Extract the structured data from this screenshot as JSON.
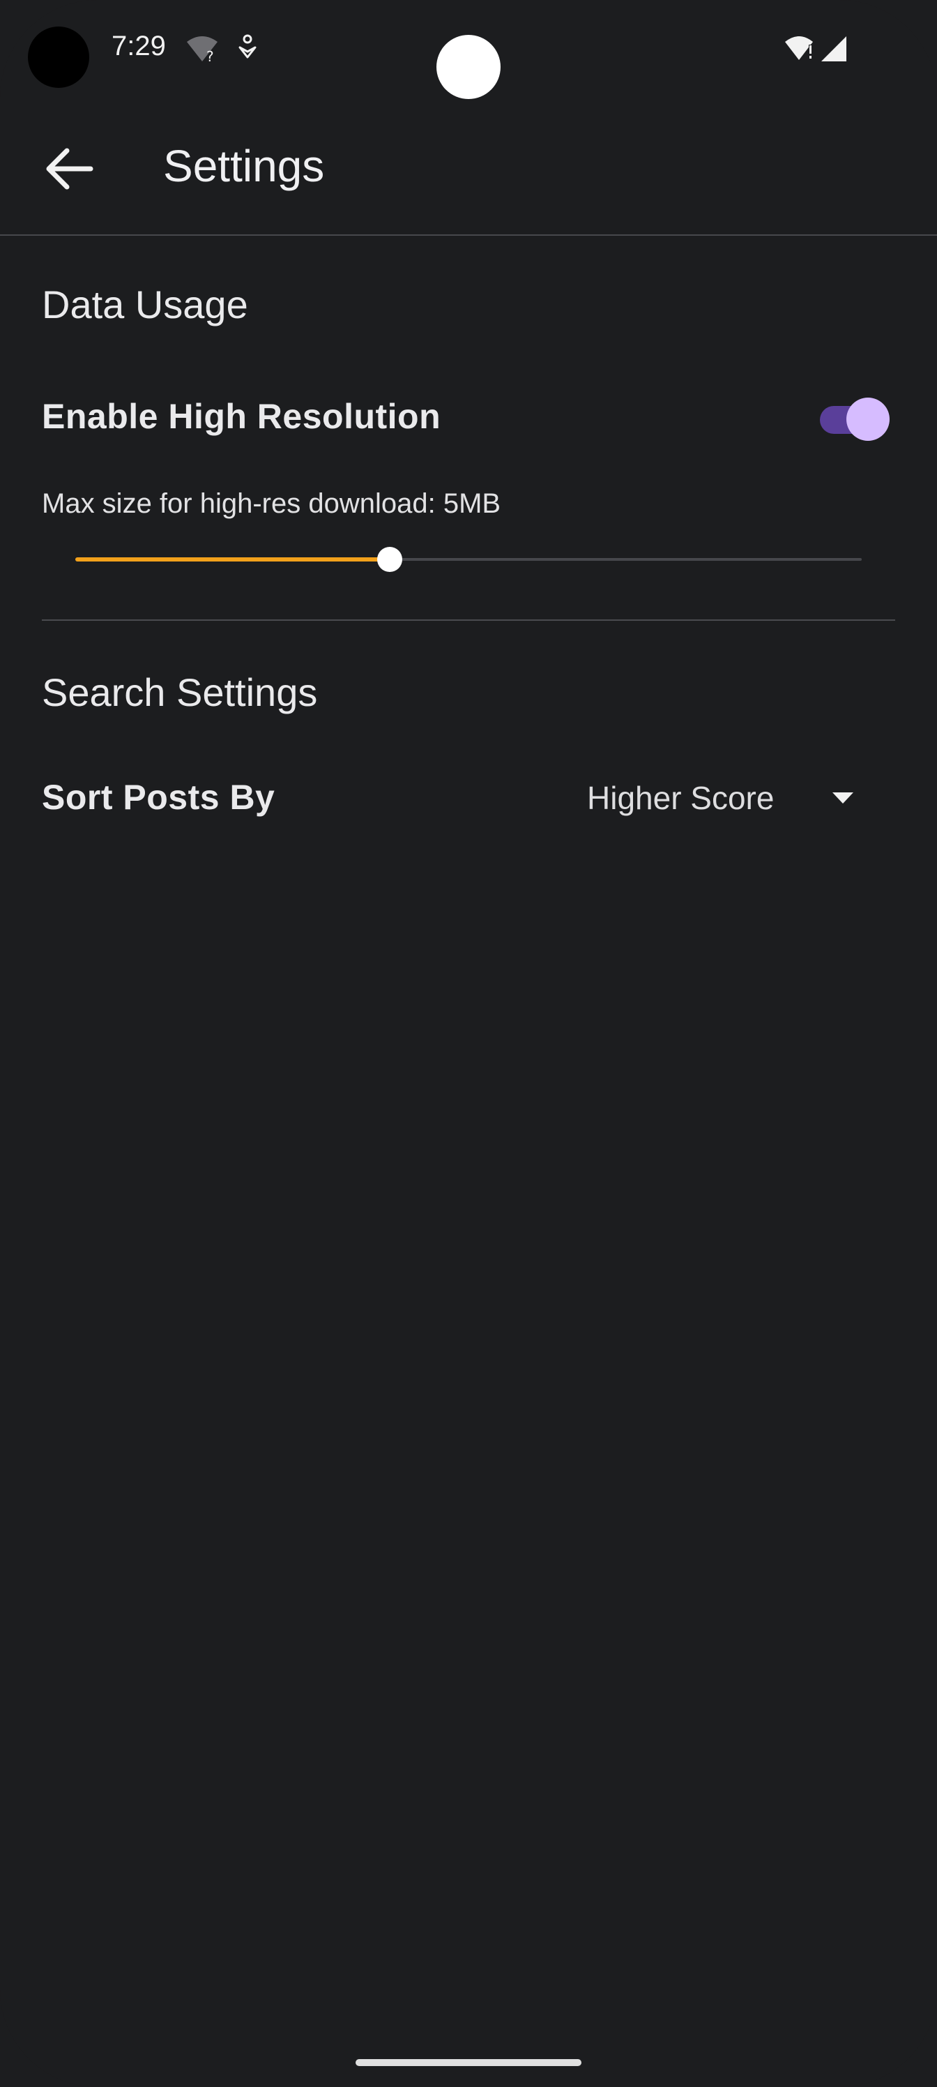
{
  "status_bar": {
    "time": "7:29"
  },
  "app_bar": {
    "title": "Settings"
  },
  "data_usage": {
    "section_title": "Data Usage",
    "high_res_label": "Enable High Resolution",
    "high_res_enabled": true,
    "slider_caption": "Max size for high-res download: 5MB",
    "slider_fraction": 0.4
  },
  "search_settings": {
    "section_title": "Search Settings",
    "sort_label": "Sort Posts By",
    "sort_value": "Higher Score"
  },
  "colors": {
    "background": "#1c1d1f",
    "toggle_track": "#5a3f9a",
    "toggle_thumb": "#d6bcff",
    "slider_fill": "#f2a11b"
  },
  "icons": {
    "back": "arrow-left-icon",
    "dropdown": "caret-down-icon",
    "wifi_unknown": "wifi-question-icon",
    "assistant": "assistant-icon",
    "wifi": "wifi-alert-icon",
    "signal": "cell-signal-icon"
  }
}
